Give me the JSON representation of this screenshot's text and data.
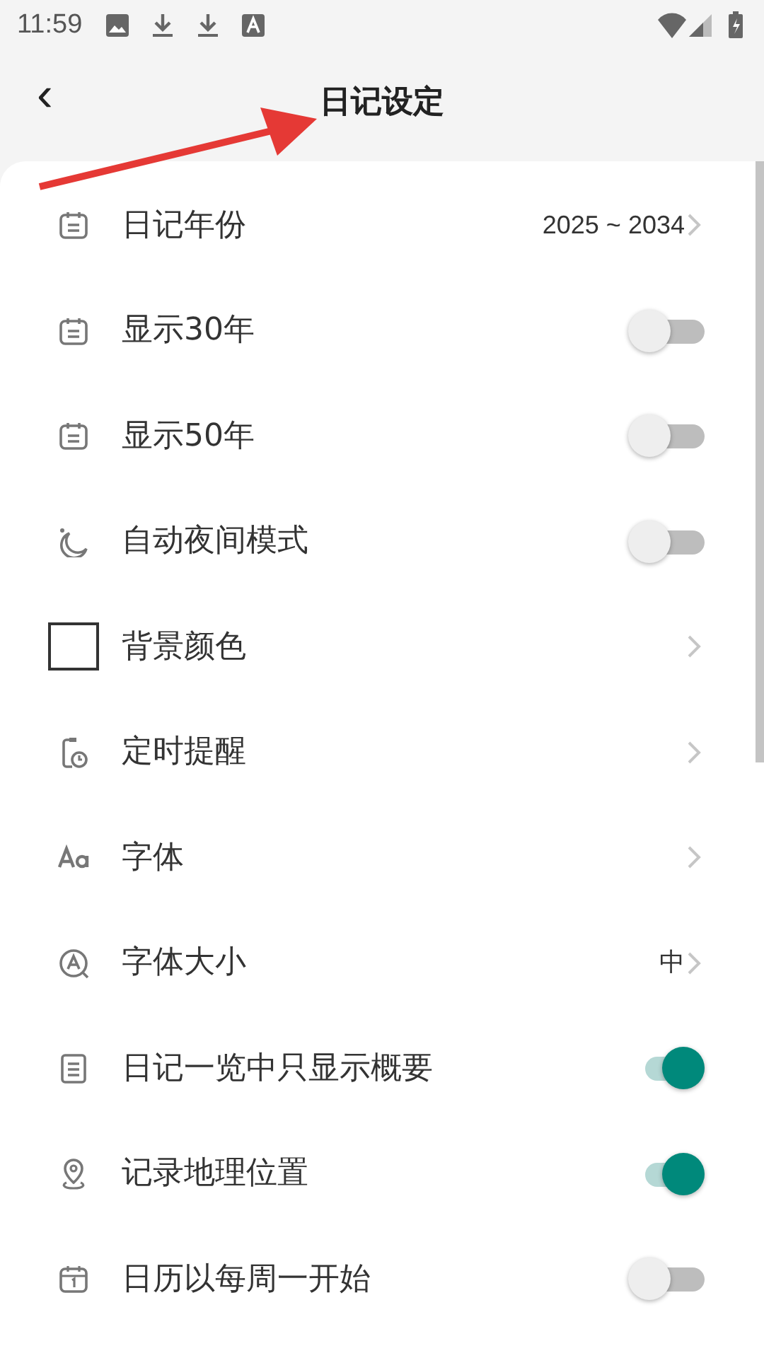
{
  "status_bar": {
    "time": "11:59"
  },
  "header": {
    "back": "‹",
    "title": "日记设定"
  },
  "settings": [
    {
      "kind": "value",
      "label": "日记年份",
      "value": "2025 ~ 2034"
    },
    {
      "kind": "toggle",
      "label": "显示30年",
      "on": false
    },
    {
      "kind": "toggle",
      "label": "显示50年",
      "on": false
    },
    {
      "kind": "toggle",
      "label": "自动夜间模式",
      "on": false
    },
    {
      "kind": "color",
      "label": "背景颜色",
      "color": "#ffffff"
    },
    {
      "kind": "link",
      "label": "定时提醒"
    },
    {
      "kind": "link",
      "label": "字体"
    },
    {
      "kind": "value",
      "label": "字体大小",
      "value": "中"
    },
    {
      "kind": "toggle",
      "label": "日记一览中只显示概要",
      "on": true
    },
    {
      "kind": "toggle",
      "label": "记录地理位置",
      "on": true
    },
    {
      "kind": "toggle",
      "label": "日历以每周一开始",
      "on": false
    }
  ],
  "annotation": {
    "kind": "arrow",
    "color": "#e53935"
  }
}
